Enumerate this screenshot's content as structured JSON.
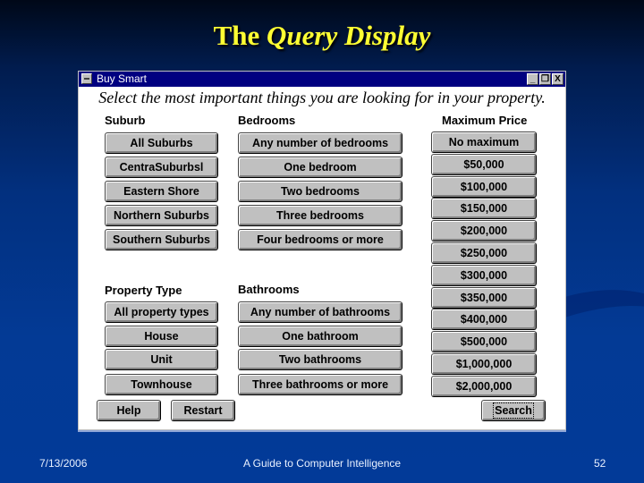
{
  "slide": {
    "title_plain": "The ",
    "title_italic": "Query Display",
    "footer": {
      "date": "7/13/2006",
      "caption": "A Guide to Computer Intelligence",
      "page": "52"
    }
  },
  "window": {
    "title": "Buy Smart",
    "controls": {
      "minimize": "_",
      "restore": "❐",
      "close": "X"
    },
    "instruction": "Select the most important things you are looking for in your property.",
    "groups": {
      "suburb": {
        "label": "Suburb",
        "options": [
          "All Suburbs",
          "CentraSuburbsl",
          "Eastern Shore",
          "Northern Suburbs",
          "Southern Suburbs"
        ]
      },
      "bedrooms": {
        "label": "Bedrooms",
        "options": [
          "Any number of bedrooms",
          "One bedroom",
          "Two bedrooms",
          "Three bedrooms",
          "Four bedrooms or more"
        ]
      },
      "max_price": {
        "label": "Maximum Price",
        "options": [
          "No maximum",
          "$50,000",
          "$100,000",
          "$150,000",
          "$200,000",
          "$250,000",
          "$300,000",
          "$350,000",
          "$400,000",
          "$500,000",
          "$1,000,000",
          "$2,000,000"
        ]
      },
      "property_type": {
        "label": "Property Type",
        "options": [
          "All property types",
          "House",
          "Unit",
          "Townhouse"
        ]
      },
      "bathrooms": {
        "label": "Bathrooms",
        "options": [
          "Any number of bathrooms",
          "One bathroom",
          "Two bathrooms",
          "Three bathrooms or more"
        ]
      }
    },
    "actions": {
      "help": "Help",
      "restart": "Restart",
      "search": "Search"
    }
  }
}
